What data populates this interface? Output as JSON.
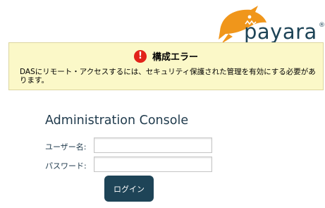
{
  "logo": {
    "text": "payara",
    "registered_mark": "®",
    "icon": "payara-fish-logo",
    "colors": {
      "fish": "#f0961b",
      "wordmark": "#1e4457"
    }
  },
  "error": {
    "icon": "error-exclamation-icon",
    "icon_glyph": "!",
    "icon_color": "#e2231a",
    "title": "構成エラー",
    "message": "DASにリモート・アクセスするには、セキュリティ保護された管理を有効にする必要があります。",
    "background": "#fbf8c8"
  },
  "login": {
    "title": "Administration Console",
    "username_label": "ユーザー名:",
    "password_label": "パスワード:",
    "username_value": "",
    "password_value": "",
    "submit_label": "ログイン",
    "button_color": "#1e4457"
  }
}
